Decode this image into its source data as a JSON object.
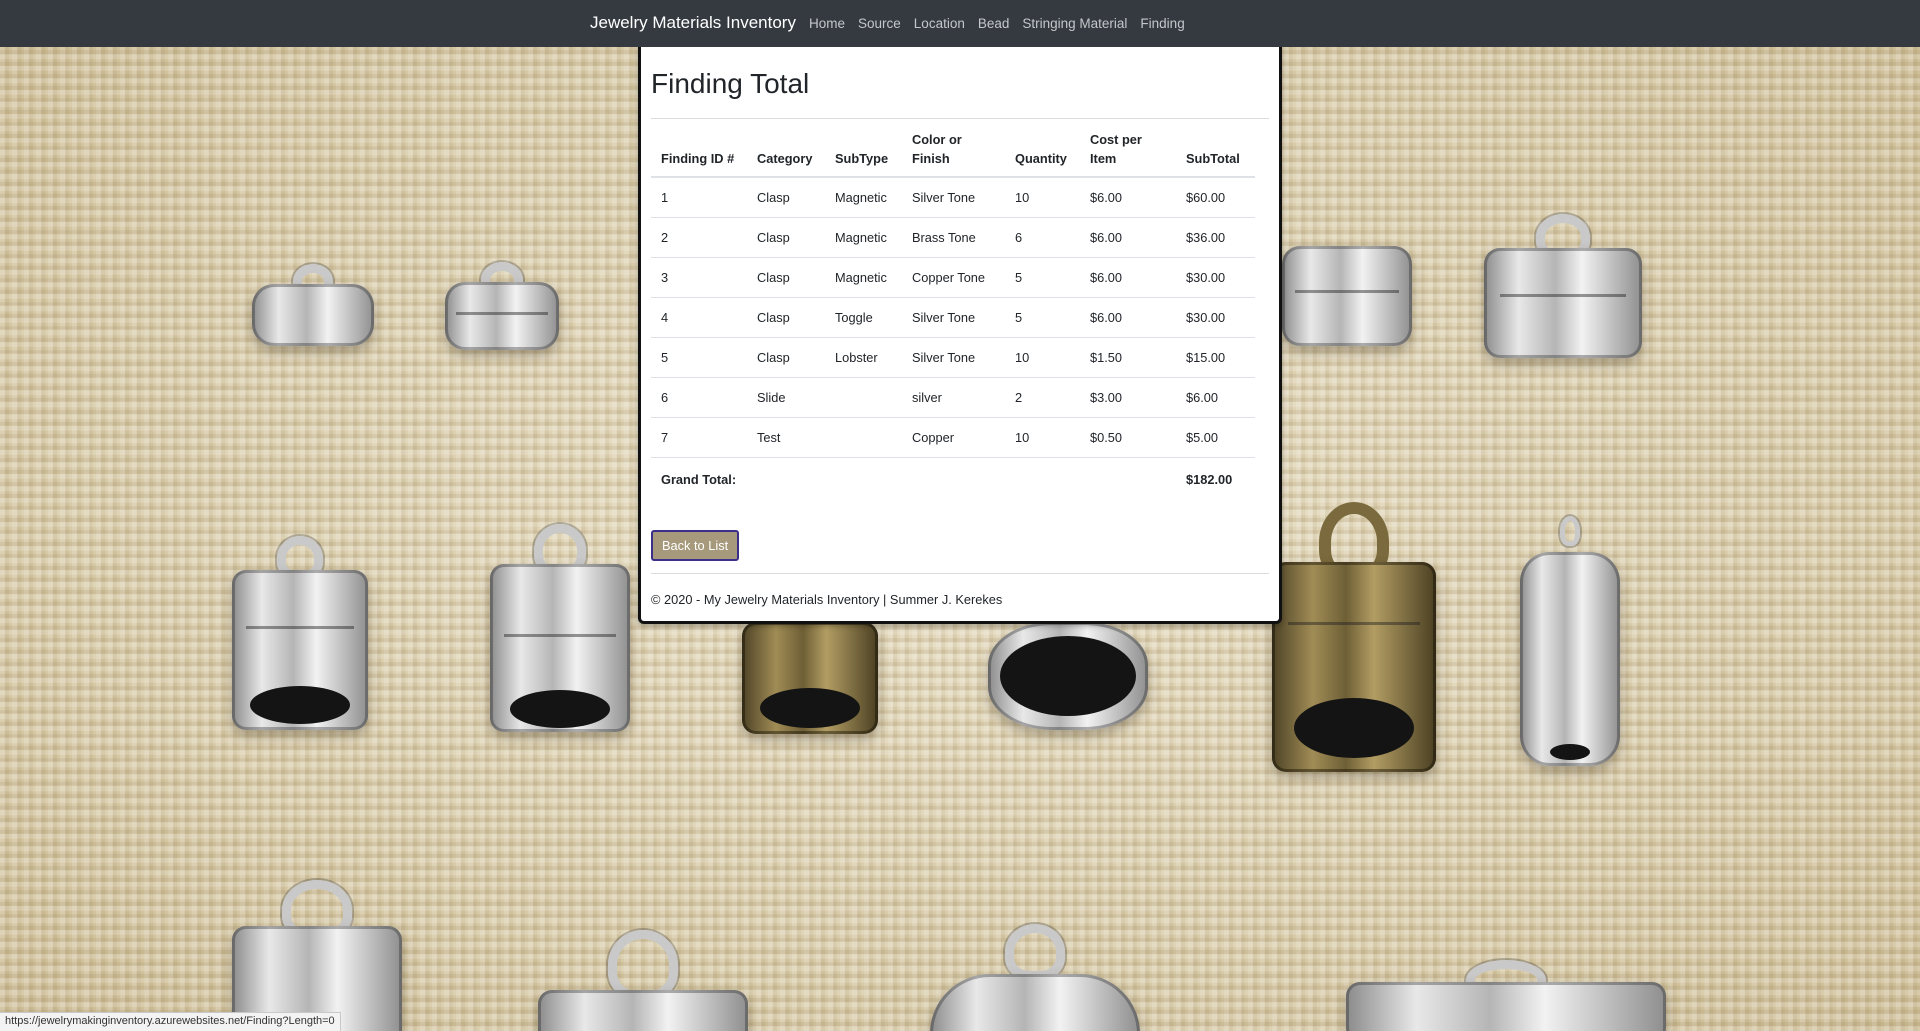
{
  "nav": {
    "brand": "Jewelry Materials Inventory",
    "links": [
      "Home",
      "Source",
      "Location",
      "Bead",
      "Stringing Material",
      "Finding"
    ]
  },
  "page": {
    "title": "Finding Total",
    "columns": [
      "Finding ID #",
      "Category",
      "SubType",
      "Color or Finish",
      "Quantity",
      "Cost per Item",
      "SubTotal"
    ],
    "rows": [
      [
        "1",
        "Clasp",
        "Magnetic",
        "Silver Tone",
        "10",
        "$6.00",
        "$60.00"
      ],
      [
        "2",
        "Clasp",
        "Magnetic",
        "Brass Tone",
        "6",
        "$6.00",
        "$36.00"
      ],
      [
        "3",
        "Clasp",
        "Magnetic",
        "Copper Tone",
        "5",
        "$6.00",
        "$30.00"
      ],
      [
        "4",
        "Clasp",
        "Toggle",
        "Silver Tone",
        "5",
        "$6.00",
        "$30.00"
      ],
      [
        "5",
        "Clasp",
        "Lobster",
        "Silver Tone",
        "10",
        "$1.50",
        "$15.00"
      ],
      [
        "6",
        "Slide",
        "",
        "silver",
        "2",
        "$3.00",
        "$6.00"
      ],
      [
        "7",
        "Test",
        "",
        "Copper",
        "10",
        "$0.50",
        "$5.00"
      ]
    ],
    "grand_total_label": "Grand Total:",
    "grand_total_value": "$182.00",
    "back_button": "Back to List",
    "footer": "© 2020 - My Jewelry Materials Inventory | Summer J. Kerekes"
  },
  "status_url": "https://jewelrymakinginventory.azurewebsites.net/Finding?Length=0",
  "colors": {
    "navbar": "#343a40",
    "button": "#a79a7c",
    "button_border": "#3b2f8a"
  }
}
